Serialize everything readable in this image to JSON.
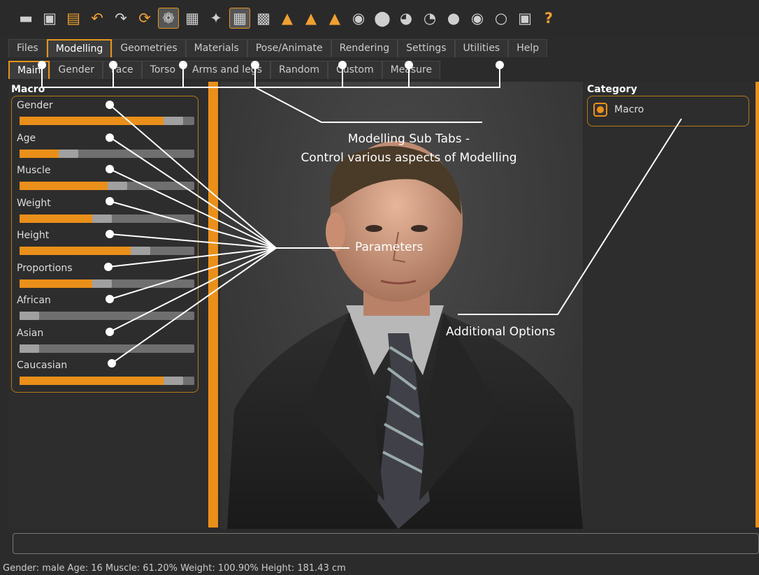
{
  "toolbar": {
    "icons": [
      "app-icon",
      "save-icon",
      "export-icon",
      "undo-icon",
      "redo-icon",
      "reset-icon",
      "smooth-icon",
      "wireframe-icon",
      "skeleton-icon",
      "grid-icon",
      "checker-icon",
      "symmetry-right-icon",
      "symmetry-left-icon",
      "symmetry-icon",
      "front-view-icon",
      "back-view-icon",
      "left-view-icon",
      "right-view-icon",
      "top-view-icon",
      "bottom-view-icon",
      "reset-camera-icon",
      "screenshot-icon",
      "help-icon"
    ]
  },
  "main_tabs": [
    "Files",
    "Modelling",
    "Geometries",
    "Materials",
    "Pose/Animate",
    "Rendering",
    "Settings",
    "Utilities",
    "Help"
  ],
  "active_main_tab": "Modelling",
  "sub_tabs": [
    "Main",
    "Gender",
    "Face",
    "Torso",
    "Arms and legs",
    "Random",
    "Custom",
    "Measure"
  ],
  "active_sub_tab": "Main",
  "macro": {
    "title": "Macro",
    "params": [
      {
        "label": "Gender",
        "value": 0.88
      },
      {
        "label": "Age",
        "value": 0.28
      },
      {
        "label": "Muscle",
        "value": 0.56
      },
      {
        "label": "Weight",
        "value": 0.47
      },
      {
        "label": "Height",
        "value": 0.69
      },
      {
        "label": "Proportions",
        "value": 0.47
      },
      {
        "label": "African",
        "value": 0.0
      },
      {
        "label": "Asian",
        "value": 0.0
      },
      {
        "label": "Caucasian",
        "value": 0.88
      }
    ]
  },
  "category": {
    "title": "Category",
    "options": [
      "Macro"
    ],
    "selected": "Macro"
  },
  "annotations": {
    "subtabs_line1": "Modelling Sub Tabs  -",
    "subtabs_line2": "Control various aspects of Modelling",
    "parameters": "Parameters",
    "additional": "Additional Options"
  },
  "command_input": "",
  "status_text": "Gender: male Age: 16 Muscle: 61.20% Weight: 100.90% Height: 181.43 cm",
  "colors": {
    "accent": "#ea8f1a",
    "background": "#2b2b2b"
  }
}
